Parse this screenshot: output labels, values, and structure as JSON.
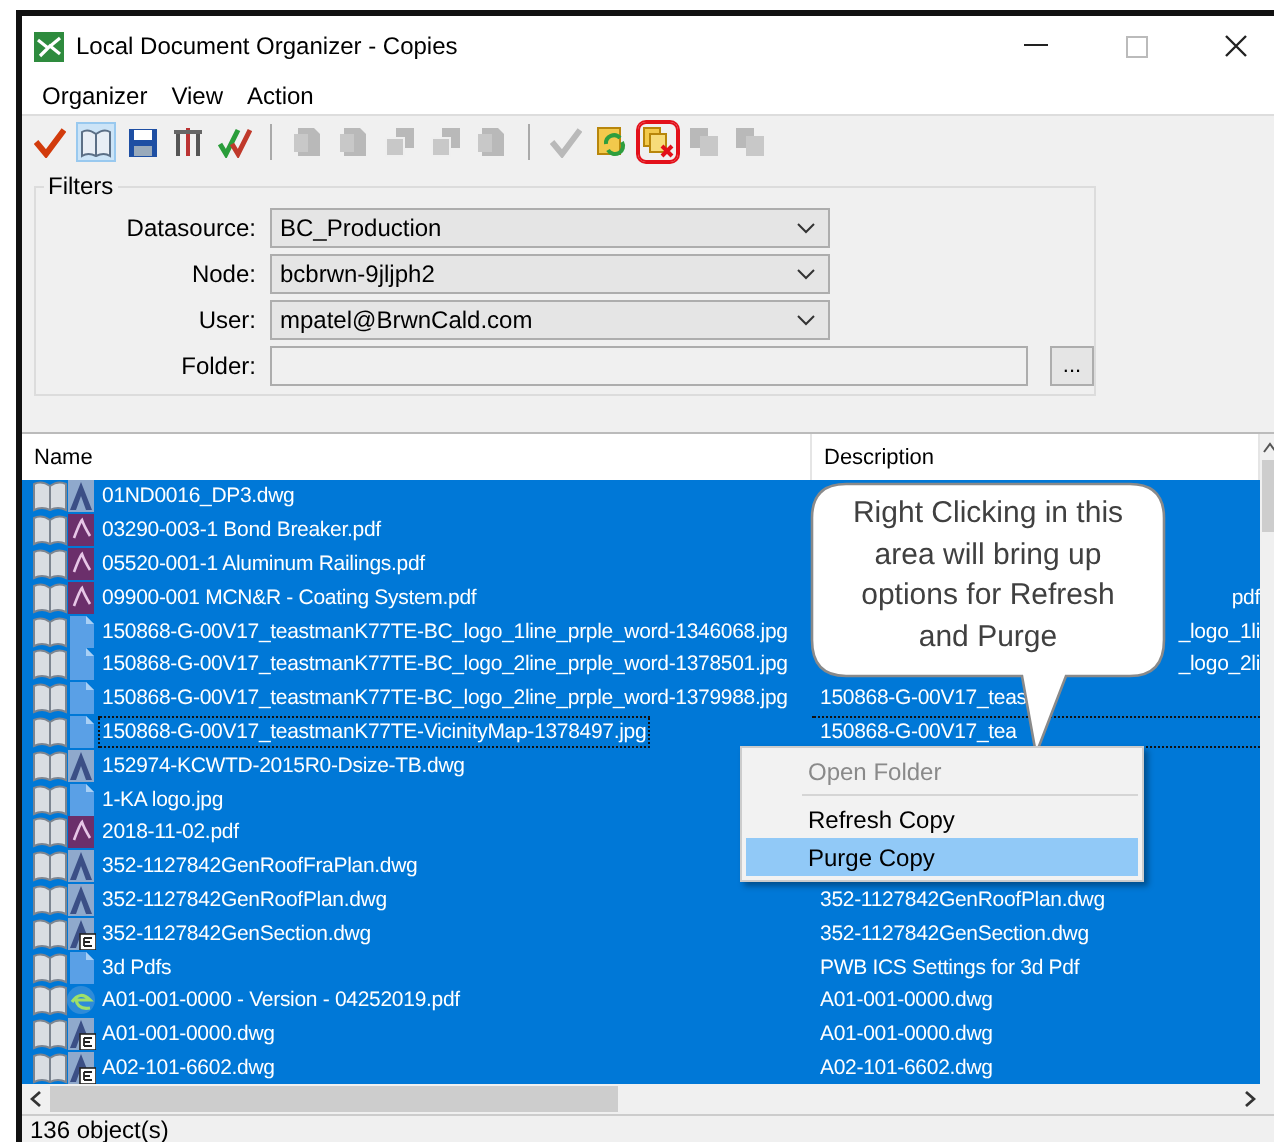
{
  "window": {
    "title": "Local Document Organizer - Copies"
  },
  "menu": [
    "Organizer",
    "View",
    "Action"
  ],
  "toolbar": [
    {
      "kind": "check",
      "disabled": false,
      "pressed": false,
      "highlighted": false
    },
    {
      "kind": "book",
      "disabled": false,
      "pressed": true,
      "highlighted": false
    },
    {
      "kind": "save",
      "disabled": false,
      "pressed": false,
      "highlighted": false
    },
    {
      "kind": "tools",
      "disabled": false,
      "pressed": false,
      "highlighted": false
    },
    {
      "kind": "validate",
      "disabled": false,
      "pressed": false,
      "highlighted": false
    },
    {
      "kind": "separator"
    },
    {
      "kind": "page",
      "disabled": true,
      "pressed": false,
      "highlighted": false
    },
    {
      "kind": "page",
      "disabled": true,
      "pressed": false,
      "highlighted": false
    },
    {
      "kind": "pages",
      "disabled": true,
      "pressed": false,
      "highlighted": false
    },
    {
      "kind": "pages",
      "disabled": true,
      "pressed": false,
      "highlighted": false
    },
    {
      "kind": "page",
      "disabled": true,
      "pressed": false,
      "highlighted": false
    },
    {
      "kind": "separator"
    },
    {
      "kind": "check",
      "disabled": true,
      "pressed": false,
      "highlighted": false
    },
    {
      "kind": "refresh",
      "disabled": false,
      "pressed": false,
      "highlighted": false
    },
    {
      "kind": "purge",
      "disabled": false,
      "pressed": false,
      "highlighted": true
    },
    {
      "kind": "transfer",
      "disabled": true,
      "pressed": false,
      "highlighted": false
    },
    {
      "kind": "transfer",
      "disabled": true,
      "pressed": false,
      "highlighted": false
    }
  ],
  "filters": {
    "title": "Filters",
    "fields": [
      {
        "kind": "select",
        "label": "Datasource:",
        "value": "BC_Production"
      },
      {
        "kind": "select",
        "label": "Node:",
        "value": "bcbrwn-9jljph2"
      },
      {
        "kind": "select",
        "label": "User:",
        "value": "mpatel@BrwnCald.com"
      },
      {
        "kind": "browse",
        "label": "Folder:",
        "button": "..."
      }
    ]
  },
  "table": {
    "columns": [
      "Name",
      "Description"
    ],
    "rows": [
      {
        "name": "01ND0016_DP3.dwg",
        "kind": "dwg",
        "badge": false,
        "selected": true,
        "focused": false
      },
      {
        "name": "03290-003-1 Bond Breaker.pdf",
        "kind": "pdf",
        "badge": false,
        "selected": true,
        "focused": false
      },
      {
        "name": "05520-001-1 Aluminum Railings.pdf",
        "kind": "pdf",
        "badge": false,
        "selected": true,
        "focused": false
      },
      {
        "name": "09900-001 MCN&R - Coating System.pdf",
        "kind": "pdf",
        "badge": false,
        "selected": true,
        "focused": false,
        "description": "pdf",
        "covered_start": true
      },
      {
        "name": "150868-G-00V17_teastmanK77TE-BC_logo_1line_prple_word-1346068.jpg",
        "kind": "image",
        "badge": false,
        "selected": true,
        "focused": false,
        "description": "_logo_1li",
        "covered_start": true
      },
      {
        "name": "150868-G-00V17_teastmanK77TE-BC_logo_2line_prple_word-1378501.jpg",
        "kind": "image",
        "badge": false,
        "selected": true,
        "focused": false,
        "description": "_logo_2li",
        "covered_start": true
      },
      {
        "name": "150868-G-00V17_teastmanK77TE-BC_logo_2line_prple_word-1379988.jpg",
        "kind": "image",
        "badge": false,
        "selected": true,
        "focused": false,
        "description": "150868-G-00V17_teas",
        "covered_start": false
      },
      {
        "name": "150868-G-00V17_teastmanK77TE-VicinityMap-1378497.jpg",
        "kind": "image",
        "badge": false,
        "selected": true,
        "focused": true,
        "description": "150868-G-00V17_tea",
        "covered_start": false
      },
      {
        "name": "152974-KCWTD-2015R0-Dsize-TB.dwg",
        "kind": "dwg",
        "badge": false,
        "selected": true,
        "focused": false
      },
      {
        "name": "1-KA logo.jpg",
        "kind": "image",
        "badge": false,
        "selected": true,
        "focused": false
      },
      {
        "name": "2018-11-02.pdf",
        "kind": "pdf",
        "badge": false,
        "selected": true,
        "focused": false
      },
      {
        "name": "352-1127842GenRoofFraPlan.dwg",
        "kind": "dwg",
        "badge": false,
        "selected": true,
        "focused": false
      },
      {
        "name": "352-1127842GenRoofPlan.dwg",
        "kind": "dwg",
        "badge": false,
        "selected": true,
        "focused": false,
        "description": "352-1127842GenRoofPlan.dwg",
        "covered_start": false
      },
      {
        "name": "352-1127842GenSection.dwg",
        "kind": "dwg",
        "badge": true,
        "selected": true,
        "focused": false,
        "description": "352-1127842GenSection.dwg",
        "covered_start": false
      },
      {
        "name": "3d Pdfs",
        "kind": "image",
        "badge": false,
        "selected": true,
        "focused": false,
        "description": "PWB ICS Settings for 3d Pdf",
        "covered_start": false
      },
      {
        "name": "A01-001-0000 - Version  - 04252019.pdf",
        "kind": "browser",
        "badge": false,
        "selected": true,
        "focused": false,
        "description": "A01-001-0000.dwg",
        "covered_start": false
      },
      {
        "name": "A01-001-0000.dwg",
        "kind": "dwg",
        "badge": true,
        "selected": true,
        "focused": false,
        "description": "A01-001-0000.dwg",
        "covered_start": false
      },
      {
        "name": "A02-101-6602.dwg",
        "kind": "dwg",
        "badge": true,
        "selected": true,
        "focused": false,
        "description": "A02-101-6602.dwg",
        "covered_start": false
      }
    ]
  },
  "callout": {
    "text": "Right Clicking in this area will bring up options for Refresh and Purge"
  },
  "context_menu": [
    {
      "label": "Open Folder",
      "disabled": true,
      "selected": false,
      "separator_after": true
    },
    {
      "label": "Refresh Copy",
      "disabled": false,
      "selected": false,
      "separator_after": false
    },
    {
      "label": "Purge Copy",
      "disabled": false,
      "selected": true,
      "separator_after": false
    }
  ],
  "status_bar": "136 object(s)"
}
